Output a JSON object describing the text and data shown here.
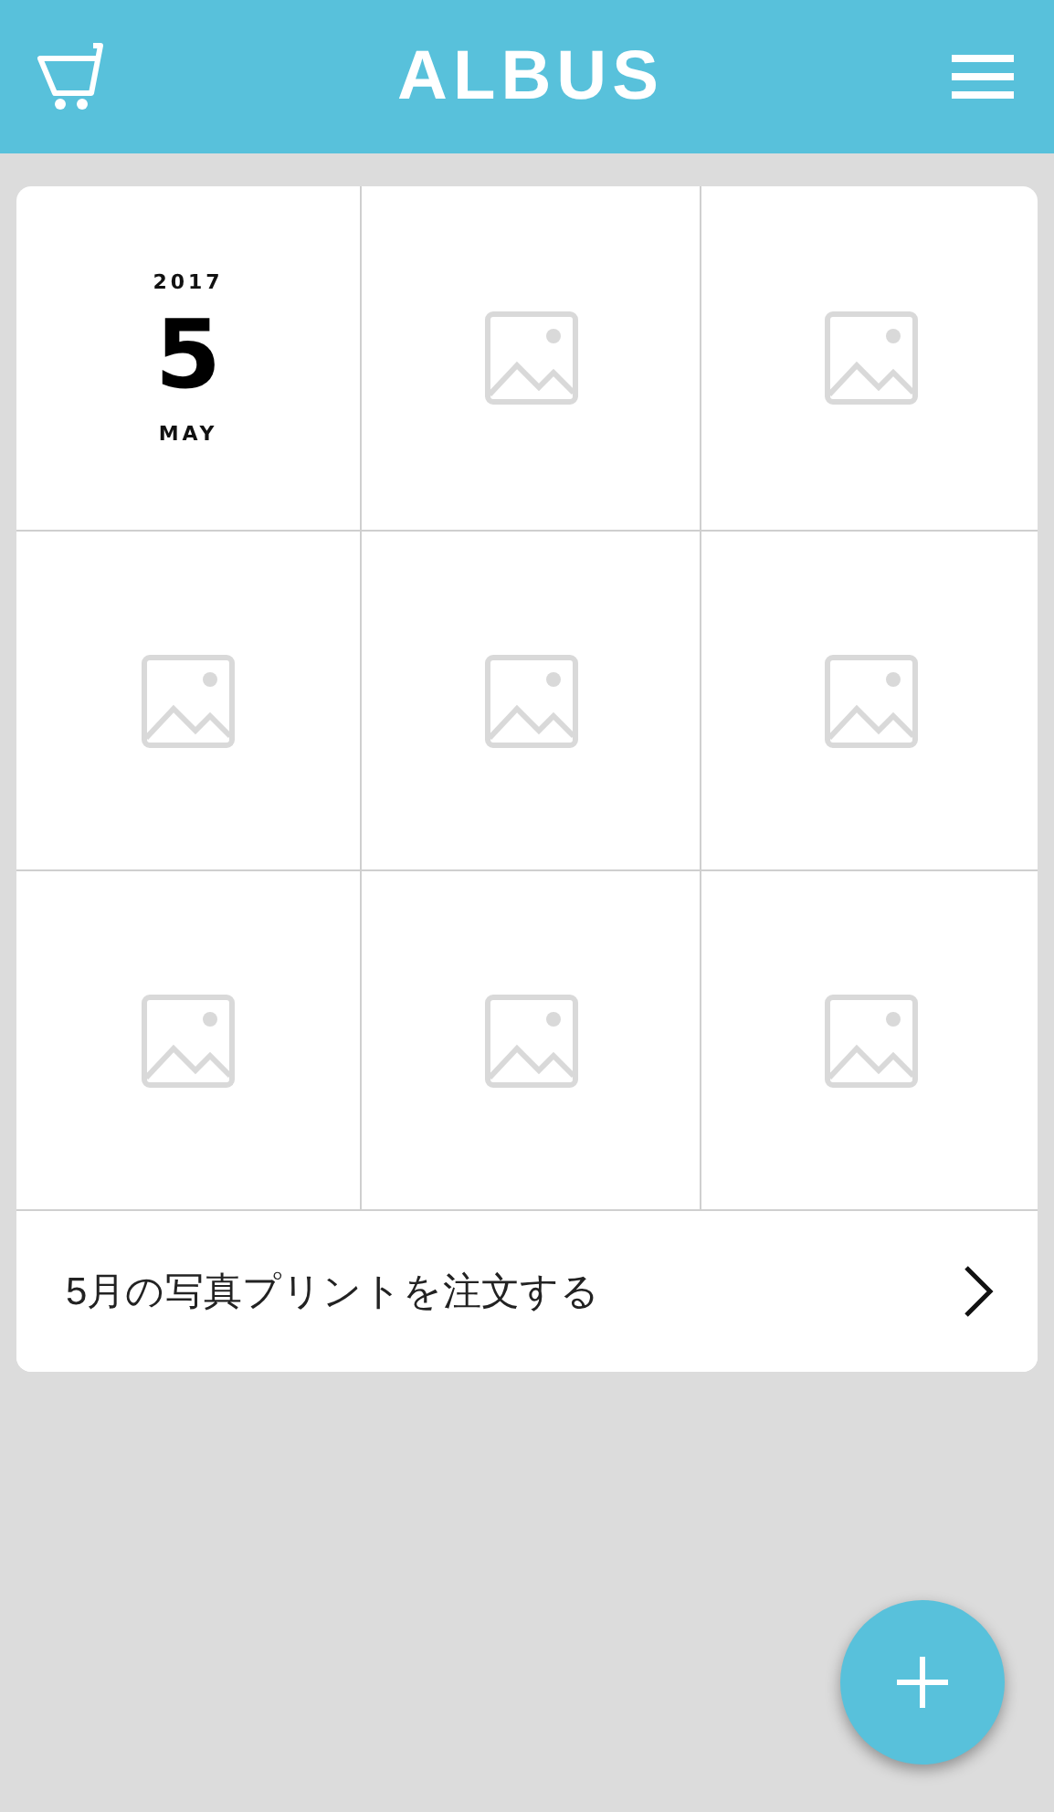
{
  "header": {
    "title": "ALBUS"
  },
  "calendar": {
    "year": "2017",
    "day": "5",
    "month": "MAY"
  },
  "photo_slots": [
    {
      "kind": "empty"
    },
    {
      "kind": "empty"
    },
    {
      "kind": "empty"
    },
    {
      "kind": "empty"
    },
    {
      "kind": "empty"
    },
    {
      "kind": "empty"
    },
    {
      "kind": "empty"
    },
    {
      "kind": "empty"
    }
  ],
  "order_link": {
    "label": "5月の写真プリントを注文する"
  }
}
